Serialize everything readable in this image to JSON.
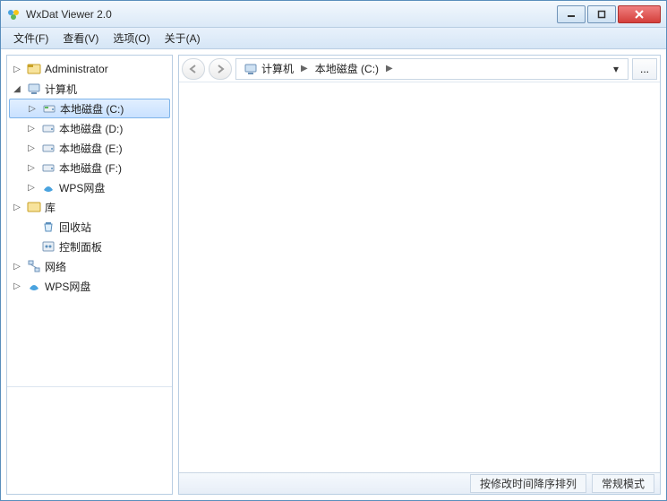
{
  "window": {
    "title": "WxDat Viewer 2.0"
  },
  "menu": {
    "file": "文件(F)",
    "view": "查看(V)",
    "options": "选项(O)",
    "about": "关于(A)"
  },
  "tree": [
    {
      "depth": 0,
      "arrow": "right",
      "icon": "user",
      "label": "Administrator"
    },
    {
      "depth": 0,
      "arrow": "down",
      "icon": "computer",
      "label": "计算机"
    },
    {
      "depth": 1,
      "arrow": "right",
      "icon": "drive-c",
      "label": "本地磁盘 (C:)",
      "selected": true
    },
    {
      "depth": 1,
      "arrow": "right",
      "icon": "drive",
      "label": "本地磁盘 (D:)"
    },
    {
      "depth": 1,
      "arrow": "right",
      "icon": "drive",
      "label": "本地磁盘 (E:)"
    },
    {
      "depth": 1,
      "arrow": "right",
      "icon": "drive",
      "label": "本地磁盘 (F:)"
    },
    {
      "depth": 1,
      "arrow": "right",
      "icon": "wps",
      "label": "WPS网盘"
    },
    {
      "depth": 0,
      "arrow": "right",
      "icon": "library",
      "label": "库"
    },
    {
      "depth": 1,
      "arrow": "none",
      "icon": "recycle",
      "label": "回收站"
    },
    {
      "depth": 1,
      "arrow": "none",
      "icon": "control",
      "label": "控制面板"
    },
    {
      "depth": 0,
      "arrow": "right",
      "icon": "network",
      "label": "网络"
    },
    {
      "depth": 0,
      "arrow": "right",
      "icon": "wps",
      "label": "WPS网盘"
    }
  ],
  "breadcrumb": {
    "root": "计算机",
    "current": "本地磁盘 (C:)"
  },
  "status": {
    "sort": "按修改时间降序排列",
    "mode": "常规模式"
  },
  "moreBtn": "..."
}
